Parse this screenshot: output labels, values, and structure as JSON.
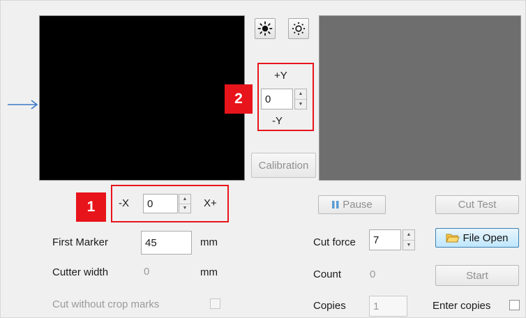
{
  "brightness": {
    "up_icon": "brightness-up-icon",
    "down_icon": "brightness-down-icon"
  },
  "y_control": {
    "plus_label": "+Y",
    "value": "0",
    "minus_label": "-Y",
    "badge": "2"
  },
  "x_control": {
    "minus_label": "-X",
    "value": "0",
    "plus_label": "X+",
    "badge": "1"
  },
  "calibration_label": "Calibration",
  "pause_label": "Pause",
  "cut_test_label": "Cut Test",
  "first_marker": {
    "label": "First Marker",
    "value": "45",
    "unit": "mm"
  },
  "cutter_width": {
    "label": "Cutter width",
    "value": "0",
    "unit": "mm"
  },
  "cut_without_crop_marks": {
    "label": "Cut without crop marks",
    "checked": false
  },
  "cut_force": {
    "label": "Cut force",
    "value": "7"
  },
  "file_open_label": "File Open",
  "count": {
    "label": "Count",
    "value": "0"
  },
  "start_label": "Start",
  "copies": {
    "label": "Copies",
    "value": "1"
  },
  "enter_copies": {
    "label": "Enter copies",
    "checked": false
  },
  "colors": {
    "accent_red": "#e8141b",
    "arrow_blue": "#3a77c6"
  }
}
